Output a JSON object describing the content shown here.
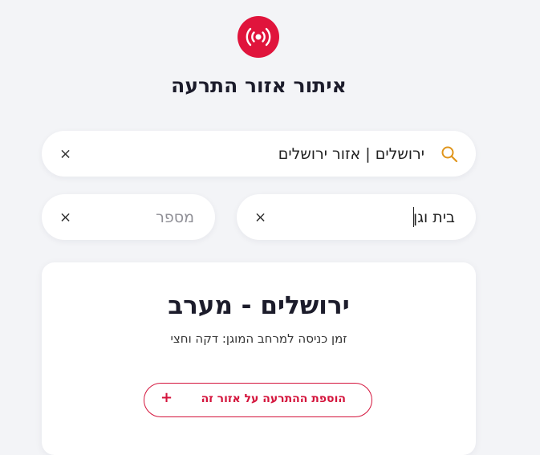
{
  "header": {
    "title": "איתור אזור התרעה",
    "logo_icon": "radio-broadcast-icon",
    "logo_color": "#e0143c"
  },
  "search": {
    "value": "ירושלים | אזור ירושלים",
    "icon": "search-icon",
    "icon_color": "#e0951c"
  },
  "address": {
    "city_value": "בית וגן",
    "number_placeholder": "מספר"
  },
  "result": {
    "area_name": "ירושלים - מערב",
    "entry_time": "זמן כניסה למרחב המוגן: דקה וחצי",
    "add_button_label": "הוספת ההתרעה על אזור זה",
    "add_button_icon": "+",
    "accent_color": "#d4143c"
  },
  "clear_icon": "×"
}
